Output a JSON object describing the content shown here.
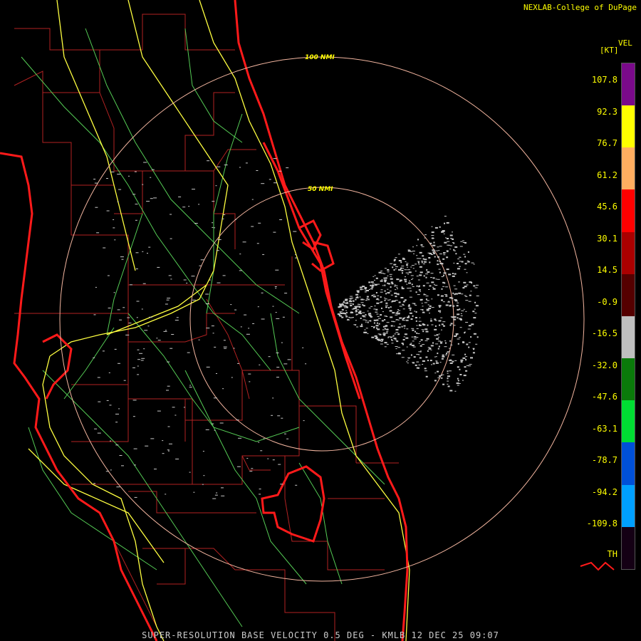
{
  "header": {
    "credit": "NEXLAB-College of DuPage"
  },
  "map": {
    "range_rings": [
      "100 NMI",
      "50 NMI"
    ],
    "colors": {
      "county": "#b22222",
      "coast": "#ff1a1a",
      "highway": "#ffff40",
      "road": "#55cc55",
      "ring": "#f4b6a0",
      "echo": "#c8c8c8"
    }
  },
  "legend": {
    "name": "VEL",
    "unit": "[KT]",
    "ticks": [
      "107.8",
      "92.3",
      "76.7",
      "61.2",
      "45.6",
      "30.1",
      "14.5",
      "-0.9",
      "-16.5",
      "-32.0",
      "-47.6",
      "-63.1",
      "-78.7",
      "-94.2",
      "-109.8",
      "TH"
    ],
    "colors": [
      "#7a0a8a",
      "#ffff00",
      "#ffae60",
      "#ff0000",
      "#aa0000",
      "#550000",
      "#bfbfbf",
      "#0a7a0a",
      "#00dd33",
      "#0050d8",
      "#00a0ff",
      "#140014"
    ]
  },
  "footer": {
    "product": "SUPER-RESOLUTION BASE VELOCITY 0.5 DEG - KMLB 12 DEC 25 09:07"
  }
}
